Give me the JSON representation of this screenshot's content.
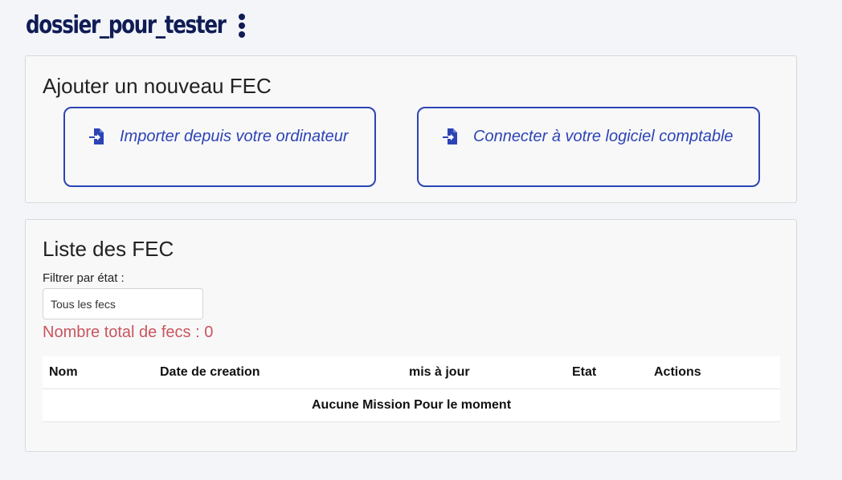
{
  "header": {
    "project_title": "dossier_pour_tester",
    "menu_icon": "kebab-menu-icon"
  },
  "add_section": {
    "title": "Ajouter un nouveau FEC",
    "import_label": "Importer depuis votre ordinateur",
    "connect_label": "Connecter à votre logiciel comptable",
    "icon": "file-import-icon",
    "accent_color": "#2d44b5"
  },
  "list_section": {
    "title": "Liste des FEC",
    "filter_label": "Filtrer par état :",
    "filter_selected": "Tous les fecs",
    "total_count_text": "Nombre total de fecs : 0",
    "columns": [
      "Nom",
      "Date de creation",
      "mis à jour",
      "Etat",
      "Actions"
    ],
    "empty_message": "Aucune Mission Pour le moment"
  }
}
